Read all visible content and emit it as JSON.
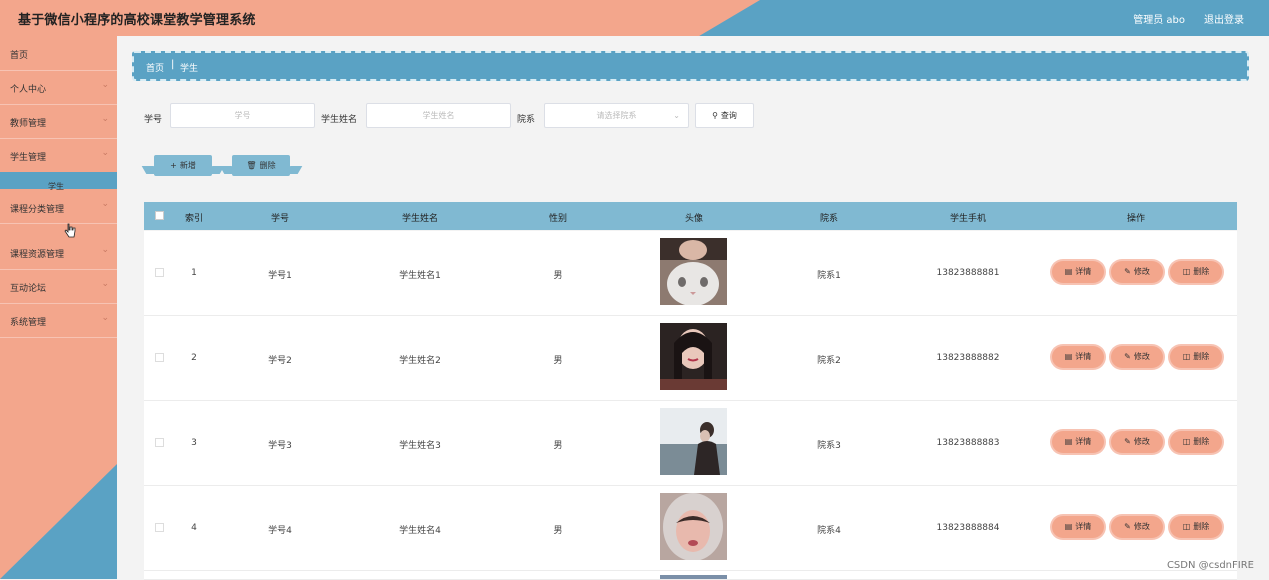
{
  "header": {
    "title": "基于微信小程序的高校课堂教学管理系统",
    "user": "管理员 abo",
    "logout": "退出登录"
  },
  "sidebar": {
    "items": [
      {
        "label": "首页",
        "has_chevron": false
      },
      {
        "label": "个人中心",
        "has_chevron": true
      },
      {
        "label": "教师管理",
        "has_chevron": true
      },
      {
        "label": "学生管理",
        "has_chevron": true
      },
      {
        "label": "课程分类管理",
        "has_chevron": true
      },
      {
        "label": "课程资源管理",
        "has_chevron": true
      },
      {
        "label": "互动论坛",
        "has_chevron": true
      },
      {
        "label": "系统管理",
        "has_chevron": true
      }
    ],
    "submenu": {
      "label": "学生"
    }
  },
  "breadcrumb": {
    "home": "首页",
    "separator": "|",
    "current": "学生"
  },
  "filters": {
    "student_no": {
      "label": "学号",
      "placeholder": "学号"
    },
    "student_name": {
      "label": "学生姓名",
      "placeholder": "学生姓名"
    },
    "department": {
      "label": "院系",
      "placeholder": "请选择院系"
    },
    "query_button": "查询"
  },
  "actions": {
    "add": "新增",
    "delete": "删除"
  },
  "table": {
    "columns": {
      "index": "索引",
      "student_no": "学号",
      "name": "学生姓名",
      "gender": "性别",
      "avatar": "头像",
      "department": "院系",
      "phone": "学生手机",
      "ops": "操作"
    },
    "ops": {
      "detail": "详情",
      "edit": "修改",
      "delete": "删除"
    },
    "rows": [
      {
        "index": "1",
        "student_no": "学号1",
        "name": "学生姓名1",
        "gender": "男",
        "department": "院系1",
        "phone": "13823888881"
      },
      {
        "index": "2",
        "student_no": "学号2",
        "name": "学生姓名2",
        "gender": "男",
        "department": "院系2",
        "phone": "13823888882"
      },
      {
        "index": "3",
        "student_no": "学号3",
        "name": "学生姓名3",
        "gender": "男",
        "department": "院系3",
        "phone": "13823888883"
      },
      {
        "index": "4",
        "student_no": "学号4",
        "name": "学生姓名4",
        "gender": "男",
        "department": "院系4",
        "phone": "13823888884"
      }
    ]
  },
  "watermark": "CSDN @csdnFIRE",
  "colors": {
    "accent_blue": "#5aa2c4",
    "salmon": "#f3a68c",
    "table_header": "#80b9d2"
  }
}
